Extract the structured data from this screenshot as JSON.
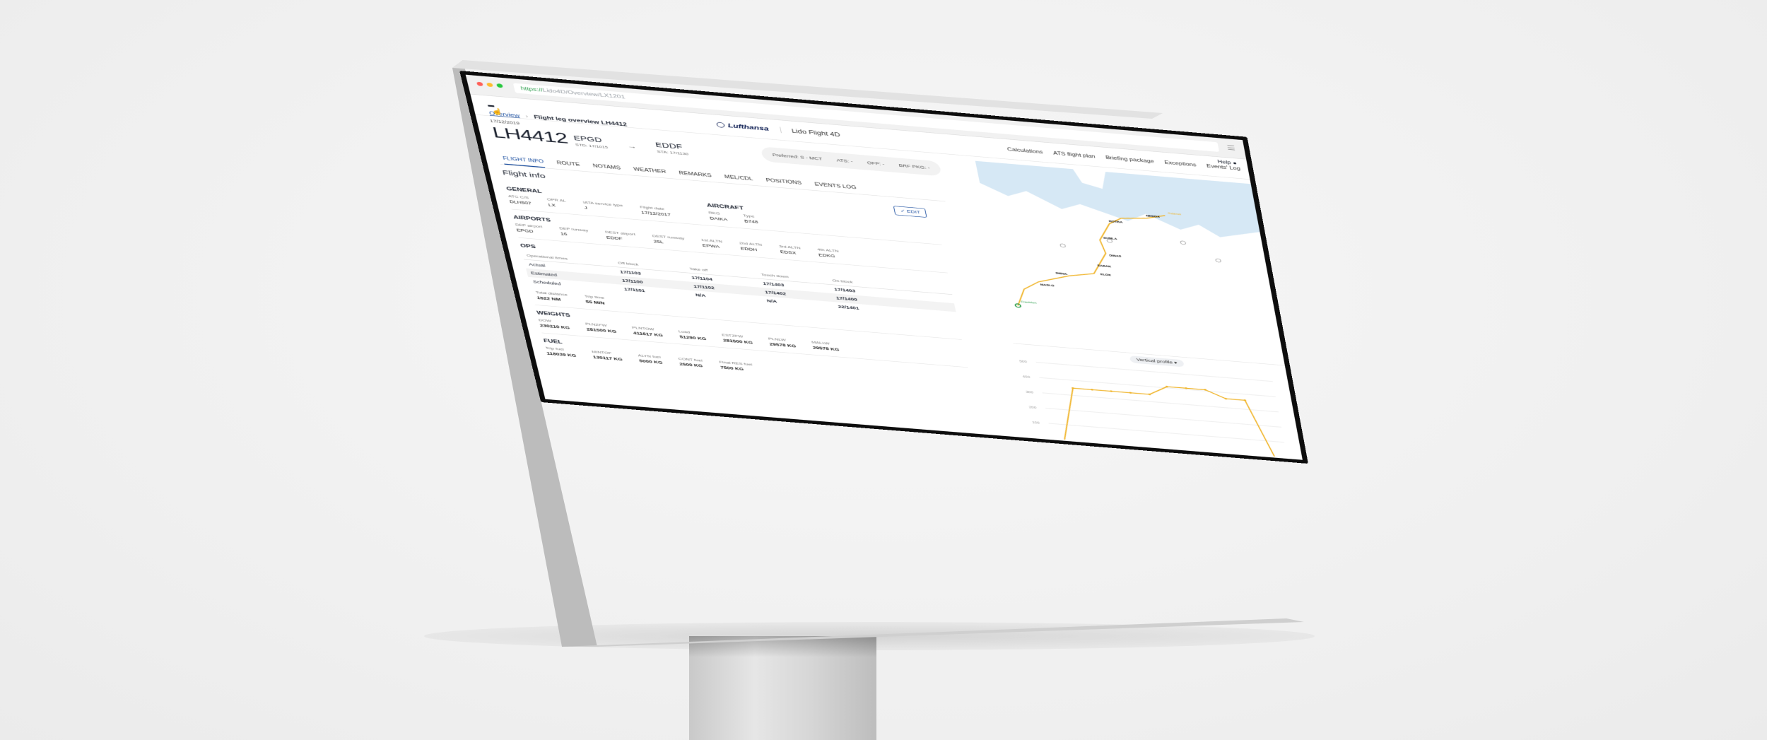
{
  "browser": {
    "url_prefix": "https://",
    "url_rest": "Lido4D/Overview/LX1201",
    "menu_icon": "hamburger-icon"
  },
  "app": {
    "menu_icon": "apps-grid-icon",
    "breadcrumb": {
      "parent": "Overview",
      "separator": "›",
      "current": "Flight leg overview LH4412"
    },
    "brand": "Lufthansa",
    "product": "Lido Flight 4D",
    "help": "Help",
    "nav": [
      "Calculations",
      "ATS flight plan",
      "Briefing package",
      "Exceptions",
      "Events' Log"
    ]
  },
  "flight": {
    "date": "17/12/2019",
    "number": "LH4412",
    "dep": {
      "code": "EPGD",
      "std": "STD: 17/1015"
    },
    "dest": {
      "code": "EDDF",
      "sta": "STA: 17/1130"
    },
    "arrow": "→",
    "preferred": [
      "Preferred: S - MCT",
      "ATS: -",
      "OFP: -",
      "BRF PKG: -"
    ]
  },
  "tabs": [
    "FLIGHT INFO",
    "ROUTE",
    "NOTAMS",
    "WEATHER",
    "REMARKS",
    "MEL/CDL",
    "POSITIONS",
    "EVENTS LOG"
  ],
  "flight_info": {
    "title": "Flight info",
    "edit": "✓ EDIT",
    "general": {
      "title": "GENERAL",
      "fields": [
        {
          "label": "ATC C/S",
          "value": "DLH507"
        },
        {
          "label": "OPR AL",
          "value": "LX"
        },
        {
          "label": "IATA service type",
          "value": "J"
        },
        {
          "label": "Flight date",
          "value": "17/12/2017"
        }
      ]
    },
    "aircraft": {
      "title": "AIRCRAFT",
      "fields": [
        {
          "label": "REG",
          "value": "DAIKA"
        },
        {
          "label": "Type",
          "value": "B748"
        }
      ]
    },
    "airports": {
      "title": "AIRPORTS",
      "fields": [
        {
          "label": "DEP airport",
          "value": "EPGD"
        },
        {
          "label": "DEP runway",
          "value": "16"
        },
        {
          "label": "DEST airport",
          "value": "EDDF"
        },
        {
          "label": "DEST runway",
          "value": "25L"
        },
        {
          "label": "1st ALTN",
          "value": "EPWA"
        },
        {
          "label": "2nd ALTN",
          "value": "EDDH"
        },
        {
          "label": "3rd ALTN",
          "value": "EDSX"
        },
        {
          "label": "4th ALTN",
          "value": "EDKG"
        }
      ]
    },
    "ops": {
      "title": "OPS",
      "headers": [
        "Operational times",
        "Off block",
        "Take off",
        "Touch down",
        "On block"
      ],
      "rows": [
        [
          "Actual",
          "17/1103",
          "17/1104",
          "17/1403",
          "17/1403"
        ],
        [
          "Estimated",
          "17/1100",
          "17/1102",
          "17/1402",
          "17/1400"
        ],
        [
          "Scheduled",
          "17/1101",
          "N/A",
          "N/A",
          "22/1401"
        ]
      ],
      "totals": [
        {
          "label": "Total distance",
          "value": "1622 NM"
        },
        {
          "label": "Trip time",
          "value": "55 MIN"
        }
      ]
    },
    "weights": {
      "title": "WEIGHTS",
      "fields": [
        {
          "label": "DOW",
          "value": "230210 KG"
        },
        {
          "label": "PLNZFW",
          "value": "281500 KG"
        },
        {
          "label": "PLNTOW",
          "value": "411617 KG"
        },
        {
          "label": "Load",
          "value": "51290 KG"
        },
        {
          "label": "ESTZFW",
          "value": "281500 KG"
        },
        {
          "label": "PLNLW",
          "value": "29578 KG"
        },
        {
          "label": "MALLW",
          "value": "29578 KG"
        }
      ]
    },
    "fuel": {
      "title": "FUEL",
      "fields": [
        {
          "label": "Trip fuel",
          "value": "118039 KG"
        },
        {
          "label": "MINTOF",
          "value": "130117 KG"
        },
        {
          "label": "ALTN fuel",
          "value": "5000 KG"
        },
        {
          "label": "CONT fuel",
          "value": "2500 KG"
        },
        {
          "label": "Final RES fuel",
          "value": "7500 KG"
        }
      ]
    }
  },
  "map": {
    "waypoints": [
      "ROTBA",
      "SUMLA",
      "DIBAS",
      "ELOK",
      "SABAK",
      "DIBOL",
      "MASLO",
      "NEDOX"
    ],
    "start_label": "Frankfurt",
    "end_label": "Gdansk"
  },
  "profile": {
    "button": "Vertical profile",
    "y_ticks": [
      "500",
      "400",
      "300",
      "200",
      "100"
    ],
    "altitude_fl": [
      0,
      290,
      290,
      290,
      290,
      290,
      340,
      340,
      340,
      300,
      300,
      0
    ]
  },
  "colors": {
    "route": "#f0b429",
    "brand_blue": "#1c4fa0",
    "water": "#d6e8f5"
  }
}
